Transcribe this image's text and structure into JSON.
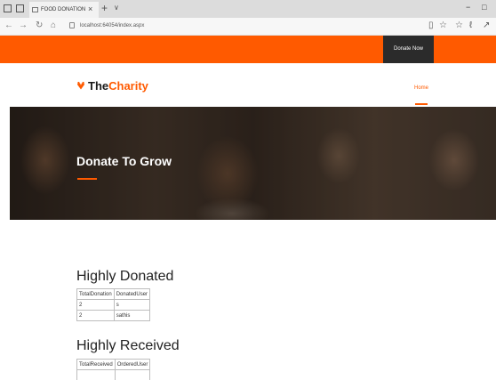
{
  "browser": {
    "tab_title": "FOOD DONATION",
    "tab_close": "×",
    "new_tab": "+",
    "tab_dropdown": "∨",
    "url": "localhost:64054/index.aspx",
    "minimize": "−",
    "maximize": "□"
  },
  "header": {
    "donate_button": "Donate Now",
    "logo_the": "The",
    "logo_charity": "Charity",
    "nav_home": "Home",
    "accent_color": "#ff5a00"
  },
  "hero": {
    "title": "Donate To Grow"
  },
  "highly_donated": {
    "title": "Highly Donated",
    "columns": [
      "TotalDonation",
      "DonatedUser"
    ],
    "rows": [
      [
        "2",
        "s"
      ],
      [
        "2",
        "sathis"
      ]
    ]
  },
  "highly_received": {
    "title": "Highly Received",
    "columns": [
      "TotalReceived",
      "OrderedUser"
    ],
    "rows": [
      [
        "",
        ""
      ]
    ]
  }
}
